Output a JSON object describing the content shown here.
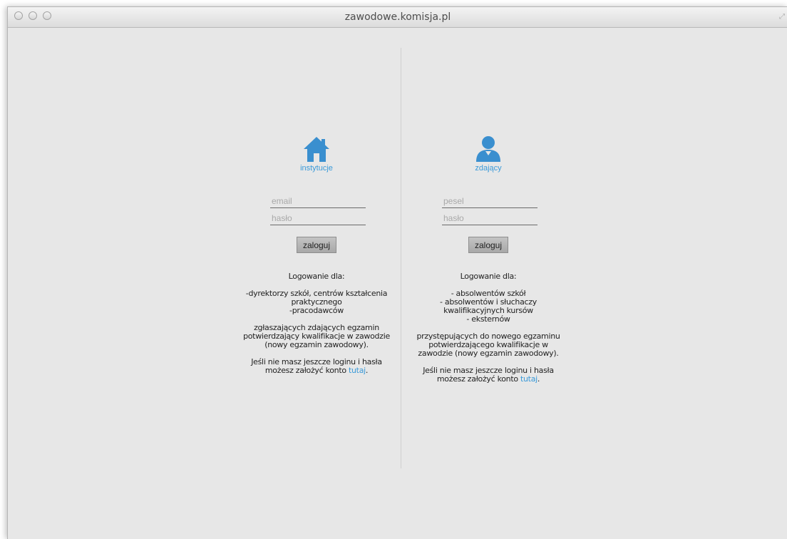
{
  "window": {
    "title": "zawodowe.komisja.pl"
  },
  "institutions": {
    "icon": "house-icon",
    "label": "instytucje",
    "email_placeholder": "email",
    "password_placeholder": "hasło",
    "login_button": "zaloguj",
    "intro": "Logowanie dla:",
    "roles": [
      "-dyrektorzy szkół, centrów kształcenia",
      "praktycznego",
      "-pracodawców"
    ],
    "description": [
      "zgłaszających zdających egzamin",
      "potwierdzający kwalifikacje w zawodzie",
      "(nowy egzamin zawodowy)."
    ],
    "signup_line1": "Jeśli nie masz jeszcze loginu i hasła",
    "signup_prefix": "możesz założyć konto ",
    "signup_link": "tutaj",
    "signup_suffix": "."
  },
  "candidates": {
    "icon": "user-icon",
    "label": "zdający",
    "pesel_placeholder": "pesel",
    "password_placeholder": "hasło",
    "login_button": "zaloguj",
    "intro": "Logowanie dla:",
    "roles": [
      "- absolwentów szkół",
      "- absolwentów i słuchaczy",
      "kwalifikacyjnych kursów",
      "- eksternów"
    ],
    "description": [
      "przystępujących do nowego egzaminu",
      "potwierdzającego kwalifikacje w",
      "zawodzie (nowy egzamin zawodowy)."
    ],
    "signup_line1": "Jeśli nie masz jeszcze loginu i hasła",
    "signup_prefix": "możesz założyć konto ",
    "signup_link": "tutaj",
    "signup_suffix": "."
  },
  "colors": {
    "accent": "#3a9ad9",
    "background": "#e7e7e7"
  }
}
